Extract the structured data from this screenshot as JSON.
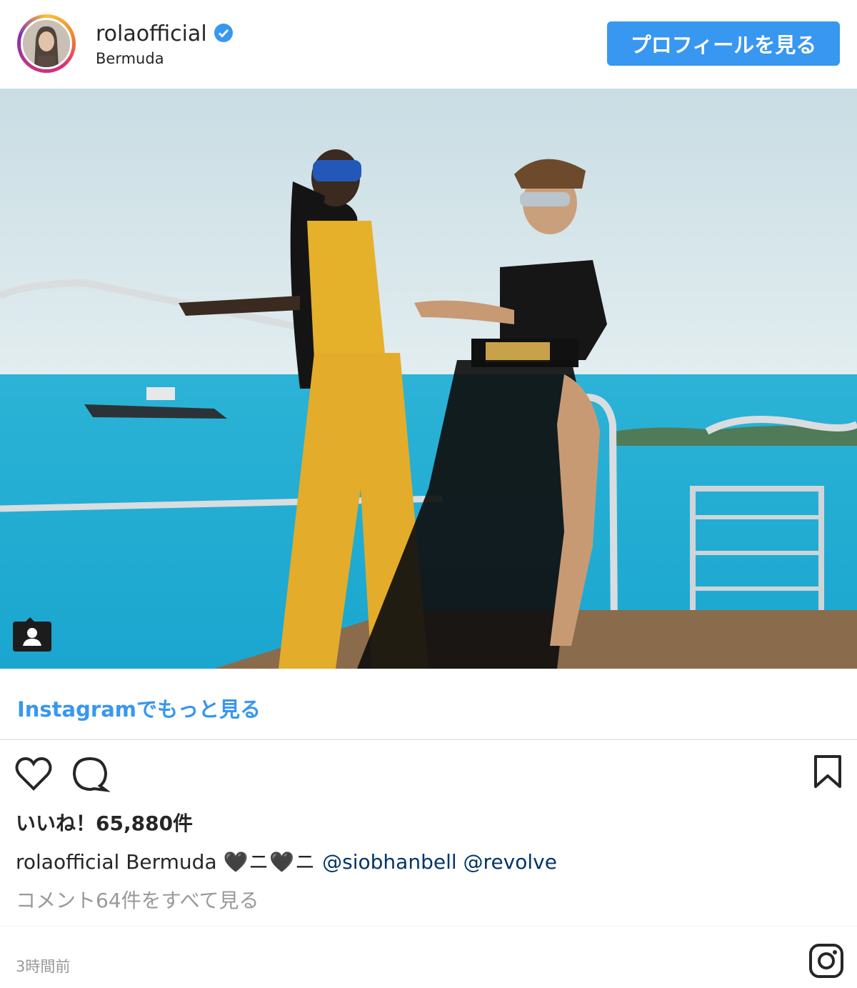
{
  "header": {
    "username": "rolaofficial",
    "location": "Bermuda",
    "profile_button": "プロフィールを見る"
  },
  "more_link": "Instagramでもっと見る",
  "likes": "いいね！65,880件",
  "caption": {
    "username": "rolaofficial",
    "text": "Bermuda",
    "hearts": "🖤ニ🖤ニ",
    "mention1": "@siobhanbell",
    "mention2": "@revolve"
  },
  "comments_link": "コメント64件をすべて見る",
  "timestamp": "3時間前",
  "icons": [
    "verified-badge-icon",
    "user-tag-icon",
    "heart-icon",
    "comment-icon",
    "bookmark-icon",
    "instagram-icon"
  ],
  "colors": {
    "accent": "#3897f0",
    "text": "#262626",
    "muted": "#999999",
    "mention": "#003569"
  }
}
